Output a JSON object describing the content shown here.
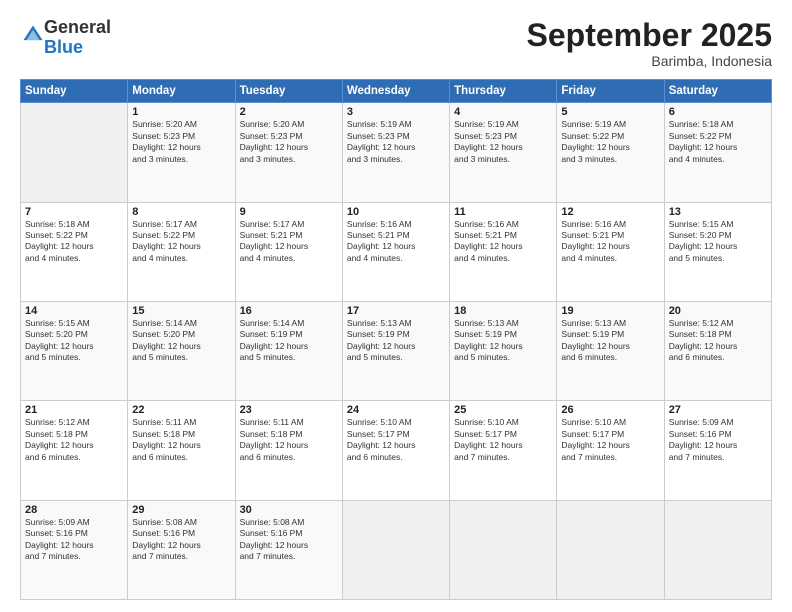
{
  "logo": {
    "general": "General",
    "blue": "Blue"
  },
  "header": {
    "month": "September 2025",
    "location": "Barimba, Indonesia"
  },
  "days_of_week": [
    "Sunday",
    "Monday",
    "Tuesday",
    "Wednesday",
    "Thursday",
    "Friday",
    "Saturday"
  ],
  "weeks": [
    [
      {
        "day": "",
        "info": ""
      },
      {
        "day": "1",
        "info": "Sunrise: 5:20 AM\nSunset: 5:23 PM\nDaylight: 12 hours\nand 3 minutes."
      },
      {
        "day": "2",
        "info": "Sunrise: 5:20 AM\nSunset: 5:23 PM\nDaylight: 12 hours\nand 3 minutes."
      },
      {
        "day": "3",
        "info": "Sunrise: 5:19 AM\nSunset: 5:23 PM\nDaylight: 12 hours\nand 3 minutes."
      },
      {
        "day": "4",
        "info": "Sunrise: 5:19 AM\nSunset: 5:23 PM\nDaylight: 12 hours\nand 3 minutes."
      },
      {
        "day": "5",
        "info": "Sunrise: 5:19 AM\nSunset: 5:22 PM\nDaylight: 12 hours\nand 3 minutes."
      },
      {
        "day": "6",
        "info": "Sunrise: 5:18 AM\nSunset: 5:22 PM\nDaylight: 12 hours\nand 4 minutes."
      }
    ],
    [
      {
        "day": "7",
        "info": "Sunrise: 5:18 AM\nSunset: 5:22 PM\nDaylight: 12 hours\nand 4 minutes."
      },
      {
        "day": "8",
        "info": "Sunrise: 5:17 AM\nSunset: 5:22 PM\nDaylight: 12 hours\nand 4 minutes."
      },
      {
        "day": "9",
        "info": "Sunrise: 5:17 AM\nSunset: 5:21 PM\nDaylight: 12 hours\nand 4 minutes."
      },
      {
        "day": "10",
        "info": "Sunrise: 5:16 AM\nSunset: 5:21 PM\nDaylight: 12 hours\nand 4 minutes."
      },
      {
        "day": "11",
        "info": "Sunrise: 5:16 AM\nSunset: 5:21 PM\nDaylight: 12 hours\nand 4 minutes."
      },
      {
        "day": "12",
        "info": "Sunrise: 5:16 AM\nSunset: 5:21 PM\nDaylight: 12 hours\nand 4 minutes."
      },
      {
        "day": "13",
        "info": "Sunrise: 5:15 AM\nSunset: 5:20 PM\nDaylight: 12 hours\nand 5 minutes."
      }
    ],
    [
      {
        "day": "14",
        "info": "Sunrise: 5:15 AM\nSunset: 5:20 PM\nDaylight: 12 hours\nand 5 minutes."
      },
      {
        "day": "15",
        "info": "Sunrise: 5:14 AM\nSunset: 5:20 PM\nDaylight: 12 hours\nand 5 minutes."
      },
      {
        "day": "16",
        "info": "Sunrise: 5:14 AM\nSunset: 5:19 PM\nDaylight: 12 hours\nand 5 minutes."
      },
      {
        "day": "17",
        "info": "Sunrise: 5:13 AM\nSunset: 5:19 PM\nDaylight: 12 hours\nand 5 minutes."
      },
      {
        "day": "18",
        "info": "Sunrise: 5:13 AM\nSunset: 5:19 PM\nDaylight: 12 hours\nand 5 minutes."
      },
      {
        "day": "19",
        "info": "Sunrise: 5:13 AM\nSunset: 5:19 PM\nDaylight: 12 hours\nand 6 minutes."
      },
      {
        "day": "20",
        "info": "Sunrise: 5:12 AM\nSunset: 5:18 PM\nDaylight: 12 hours\nand 6 minutes."
      }
    ],
    [
      {
        "day": "21",
        "info": "Sunrise: 5:12 AM\nSunset: 5:18 PM\nDaylight: 12 hours\nand 6 minutes."
      },
      {
        "day": "22",
        "info": "Sunrise: 5:11 AM\nSunset: 5:18 PM\nDaylight: 12 hours\nand 6 minutes."
      },
      {
        "day": "23",
        "info": "Sunrise: 5:11 AM\nSunset: 5:18 PM\nDaylight: 12 hours\nand 6 minutes."
      },
      {
        "day": "24",
        "info": "Sunrise: 5:10 AM\nSunset: 5:17 PM\nDaylight: 12 hours\nand 6 minutes."
      },
      {
        "day": "25",
        "info": "Sunrise: 5:10 AM\nSunset: 5:17 PM\nDaylight: 12 hours\nand 7 minutes."
      },
      {
        "day": "26",
        "info": "Sunrise: 5:10 AM\nSunset: 5:17 PM\nDaylight: 12 hours\nand 7 minutes."
      },
      {
        "day": "27",
        "info": "Sunrise: 5:09 AM\nSunset: 5:16 PM\nDaylight: 12 hours\nand 7 minutes."
      }
    ],
    [
      {
        "day": "28",
        "info": "Sunrise: 5:09 AM\nSunset: 5:16 PM\nDaylight: 12 hours\nand 7 minutes."
      },
      {
        "day": "29",
        "info": "Sunrise: 5:08 AM\nSunset: 5:16 PM\nDaylight: 12 hours\nand 7 minutes."
      },
      {
        "day": "30",
        "info": "Sunrise: 5:08 AM\nSunset: 5:16 PM\nDaylight: 12 hours\nand 7 minutes."
      },
      {
        "day": "",
        "info": ""
      },
      {
        "day": "",
        "info": ""
      },
      {
        "day": "",
        "info": ""
      },
      {
        "day": "",
        "info": ""
      }
    ]
  ]
}
